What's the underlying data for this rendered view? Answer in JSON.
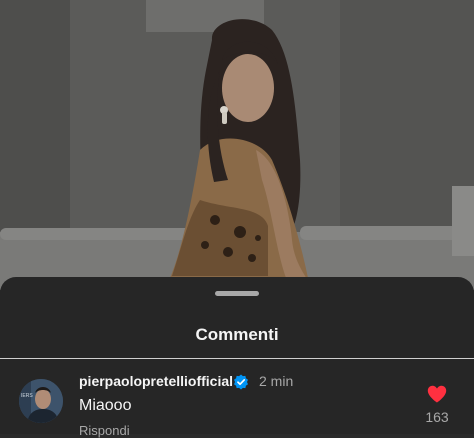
{
  "sheet": {
    "title": "Commenti"
  },
  "comment": {
    "username": "pierpaolopretelliofficial",
    "verified_icon": "verified-badge-icon",
    "time": "2 min",
    "text": "Miaooo",
    "reply_label": "Rispondi",
    "likes": "163",
    "like_icon": "heart-icon",
    "like_color": "#ff3040"
  },
  "colors": {
    "sheet_bg": "#262626",
    "text_primary": "#f5f5f5",
    "text_secondary": "#a8a8a8",
    "verified_blue": "#0095f6"
  }
}
